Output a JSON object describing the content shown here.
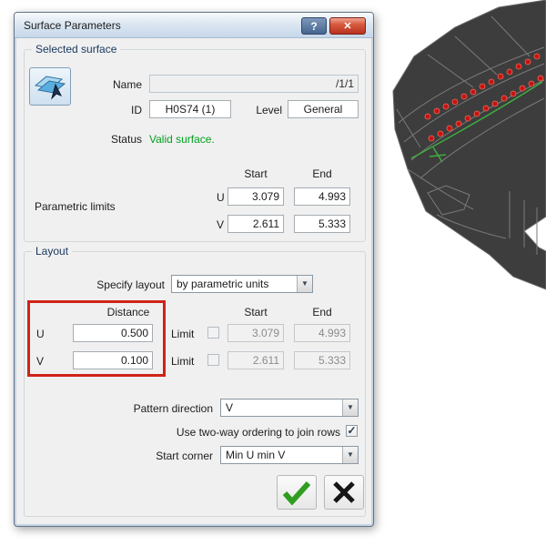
{
  "colors": {
    "status_green": "#00A01E",
    "highlight_red": "#CF2318",
    "close_button_red": "#B93120",
    "cad_background": "#3D3D3D",
    "cad_point_red": "#C41414",
    "cad_line_green": "#3FAE3F"
  },
  "icons": {
    "help": "?",
    "close": "✕",
    "dropdown_arrow": "▼",
    "check": "✓"
  },
  "titlebar": {
    "title": "Surface Parameters"
  },
  "selected_surface": {
    "group_label": "Selected surface",
    "name_label": "Name",
    "name_value": "/1/1",
    "id_label": "ID",
    "id_value": "H0S74 (1)",
    "level_label": "Level",
    "level_value": "General",
    "status_label": "Status",
    "status_value": "Valid surface.",
    "col_start": "Start",
    "col_end": "End",
    "parametric_limits_label": "Parametric limits",
    "u_label": "U",
    "v_label": "V",
    "u_start": "3.079",
    "u_end": "4.993",
    "v_start": "2.611",
    "v_end": "5.333"
  },
  "layout": {
    "group_label": "Layout",
    "specify_layout_label": "Specify layout",
    "specify_layout_value": "by parametric units",
    "distance_header": "Distance",
    "col_start": "Start",
    "col_end": "End",
    "u_label": "U",
    "v_label": "V",
    "u_distance": "0.500",
    "v_distance": "0.100",
    "limit_label": "Limit",
    "u_start": "3.079",
    "u_end": "4.993",
    "v_start": "2.611",
    "v_end": "5.333",
    "pattern_direction_label": "Pattern direction",
    "pattern_direction_value": "V",
    "two_way_label": "Use two-way ordering to join rows",
    "start_corner_label": "Start corner",
    "start_corner_value": "Min U min V"
  }
}
